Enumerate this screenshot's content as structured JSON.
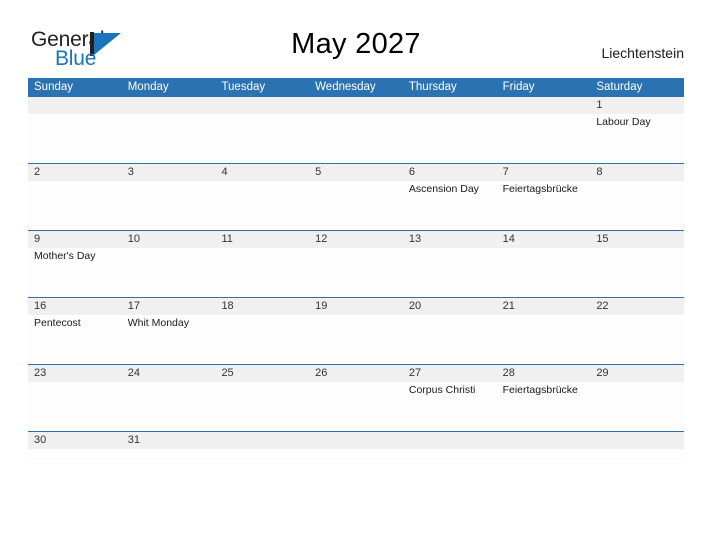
{
  "brand": {
    "name_part1": "General",
    "name_part2": "Blue",
    "logo_icon": "general-blue-flag-icon",
    "accent_color": "#1b75bc"
  },
  "header": {
    "title": "May 2027",
    "country": "Liechtenstein"
  },
  "calendar": {
    "header_bg_color": "#2b72b3",
    "row_border_color": "#2b72b3",
    "date_band_color": "#f0f0f0",
    "weekdays": [
      "Sunday",
      "Monday",
      "Tuesday",
      "Wednesday",
      "Thursday",
      "Friday",
      "Saturday"
    ],
    "weeks": [
      {
        "short": false,
        "days": [
          {
            "num": "",
            "event": ""
          },
          {
            "num": "",
            "event": ""
          },
          {
            "num": "",
            "event": ""
          },
          {
            "num": "",
            "event": ""
          },
          {
            "num": "",
            "event": ""
          },
          {
            "num": "",
            "event": ""
          },
          {
            "num": "1",
            "event": "Labour Day"
          }
        ]
      },
      {
        "short": false,
        "days": [
          {
            "num": "2",
            "event": ""
          },
          {
            "num": "3",
            "event": ""
          },
          {
            "num": "4",
            "event": ""
          },
          {
            "num": "5",
            "event": ""
          },
          {
            "num": "6",
            "event": "Ascension Day"
          },
          {
            "num": "7",
            "event": "Feiertagsbrücke"
          },
          {
            "num": "8",
            "event": ""
          }
        ]
      },
      {
        "short": false,
        "days": [
          {
            "num": "9",
            "event": "Mother's Day"
          },
          {
            "num": "10",
            "event": ""
          },
          {
            "num": "11",
            "event": ""
          },
          {
            "num": "12",
            "event": ""
          },
          {
            "num": "13",
            "event": ""
          },
          {
            "num": "14",
            "event": ""
          },
          {
            "num": "15",
            "event": ""
          }
        ]
      },
      {
        "short": false,
        "days": [
          {
            "num": "16",
            "event": "Pentecost"
          },
          {
            "num": "17",
            "event": "Whit Monday"
          },
          {
            "num": "18",
            "event": ""
          },
          {
            "num": "19",
            "event": ""
          },
          {
            "num": "20",
            "event": ""
          },
          {
            "num": "21",
            "event": ""
          },
          {
            "num": "22",
            "event": ""
          }
        ]
      },
      {
        "short": false,
        "days": [
          {
            "num": "23",
            "event": ""
          },
          {
            "num": "24",
            "event": ""
          },
          {
            "num": "25",
            "event": ""
          },
          {
            "num": "26",
            "event": ""
          },
          {
            "num": "27",
            "event": "Corpus Christi"
          },
          {
            "num": "28",
            "event": "Feiertagsbrücke"
          },
          {
            "num": "29",
            "event": ""
          }
        ]
      },
      {
        "short": true,
        "days": [
          {
            "num": "30",
            "event": ""
          },
          {
            "num": "31",
            "event": ""
          },
          {
            "num": "",
            "event": ""
          },
          {
            "num": "",
            "event": ""
          },
          {
            "num": "",
            "event": ""
          },
          {
            "num": "",
            "event": ""
          },
          {
            "num": "",
            "event": ""
          }
        ]
      }
    ]
  }
}
